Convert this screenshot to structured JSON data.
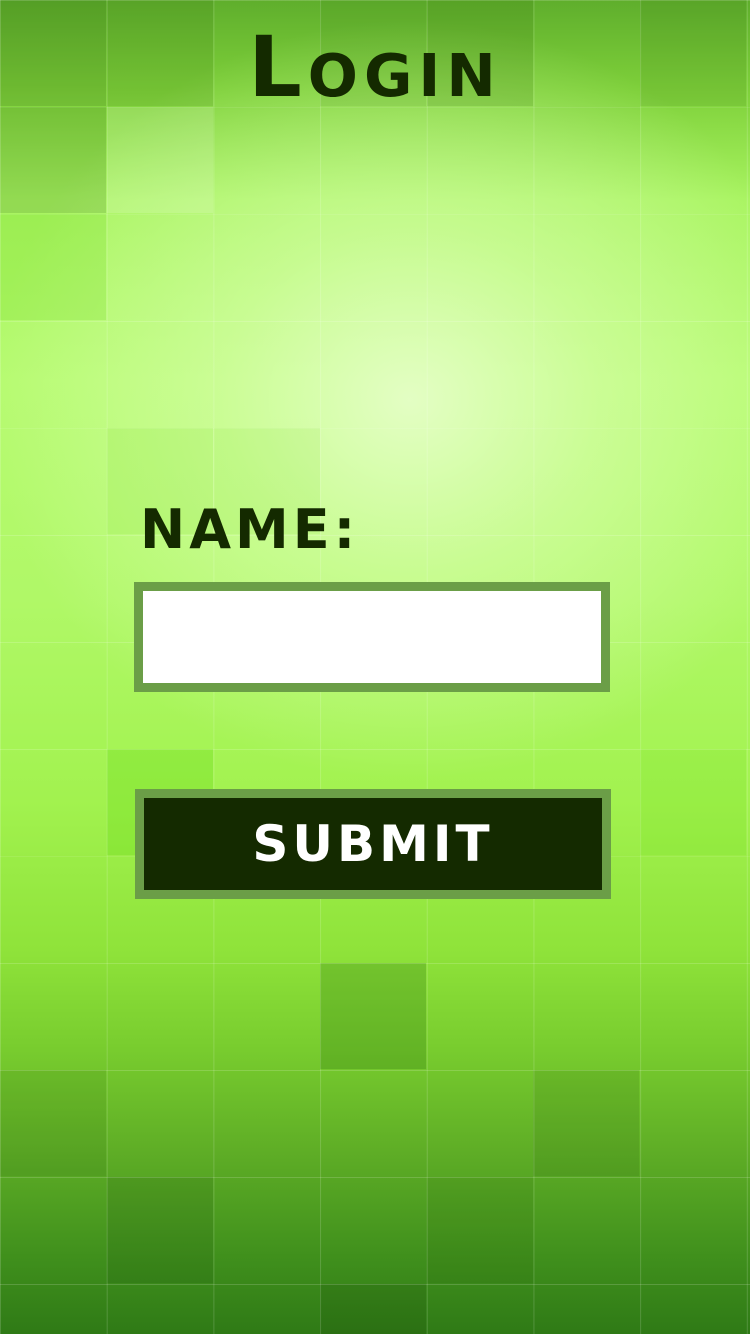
{
  "page": {
    "title": "Login"
  },
  "form": {
    "name_label": "NAME:",
    "name_value": "",
    "name_placeholder": "",
    "submit_label": "SUBMIT"
  },
  "colors": {
    "text_dark": "#142a00",
    "input_border": "#6b9e47",
    "button_background": "#142a00",
    "button_text": "#ffffff",
    "input_background": "#ffffff"
  }
}
